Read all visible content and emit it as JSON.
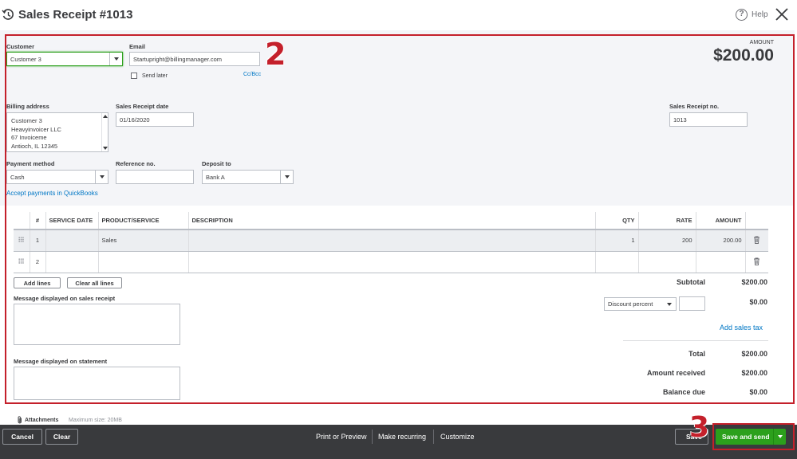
{
  "header": {
    "title": "Sales Receipt #1013",
    "help_label": "Help",
    "help_glyph": "?"
  },
  "form": {
    "customer_label": "Customer",
    "customer_value": "Customer 3",
    "email_label": "Email",
    "email_value": "Startupright@billingmanager.com",
    "send_later_label": "Send later",
    "cc_bcc_label": "Cc/Bcc",
    "amount_label": "AMOUNT",
    "amount_value": "$200.00",
    "billing_address_label": "Billing address",
    "billing_address_lines": [
      "Customer 3",
      "Heavyinvoicer LLC",
      "67 Invoiceme",
      "Antioch, IL  12345"
    ],
    "receipt_date_label": "Sales Receipt date",
    "receipt_date_value": "01/16/2020",
    "receipt_no_label": "Sales Receipt no.",
    "receipt_no_value": "1013",
    "payment_method_label": "Payment method",
    "payment_method_value": "Cash",
    "reference_no_label": "Reference no.",
    "reference_no_value": "",
    "deposit_to_label": "Deposit to",
    "deposit_to_value": "Bank A",
    "accept_payments_link": "Accept payments in QuickBooks"
  },
  "table": {
    "headers": {
      "num": "#",
      "service_date": "SERVICE DATE",
      "product": "PRODUCT/SERVICE",
      "description": "DESCRIPTION",
      "qty": "QTY",
      "rate": "RATE",
      "amount": "AMOUNT"
    },
    "rows": [
      {
        "num": "1",
        "service_date": "",
        "product": "Sales",
        "description": "",
        "qty": "1",
        "rate": "200",
        "amount": "200.00"
      },
      {
        "num": "2",
        "service_date": "",
        "product": "",
        "description": "",
        "qty": "",
        "rate": "",
        "amount": ""
      }
    ],
    "add_lines_label": "Add lines",
    "clear_lines_label": "Clear all lines"
  },
  "messages": {
    "receipt_message_label": "Message displayed on sales receipt",
    "statement_message_label": "Message displayed on statement"
  },
  "totals": {
    "subtotal_label": "Subtotal",
    "subtotal_value": "$200.00",
    "discount_type": "Discount percent",
    "discount_value": "$0.00",
    "add_sales_tax_link": "Add sales tax",
    "total_label": "Total",
    "total_value": "$200.00",
    "amount_received_label": "Amount received",
    "amount_received_value": "$200.00",
    "balance_due_label": "Balance due",
    "balance_due_value": "$0.00"
  },
  "attachments": {
    "label": "Attachments",
    "max_size": "Maximum size: 20MB"
  },
  "footer": {
    "cancel_label": "Cancel",
    "clear_label": "Clear",
    "print_preview_label": "Print or Preview",
    "make_recurring_label": "Make recurring",
    "customize_label": "Customize",
    "save_label": "Save",
    "save_send_label": "Save and send"
  },
  "annotations": {
    "badge_2": "2",
    "badge_3": "3"
  },
  "colors": {
    "accent_green": "#2ca01c",
    "link_blue": "#0077c5",
    "annotation_red": "#c4202b",
    "footer_bg": "#393a3d"
  }
}
